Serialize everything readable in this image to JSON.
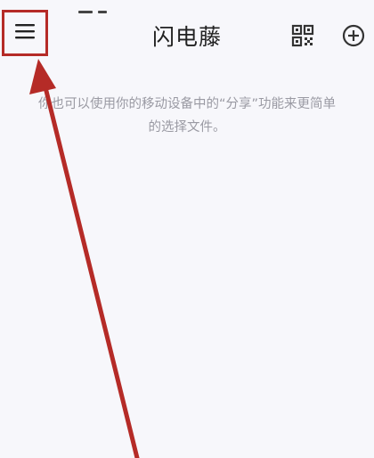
{
  "app": {
    "title": "闪电藤"
  },
  "toolbar": {
    "menu_icon": "hamburger-menu-icon",
    "qr_icon": "qr-code-icon",
    "add_icon": "add-circle-icon"
  },
  "empty_state": {
    "line1": "你也可以使用你的移动设备中的“分享”功能来更简单",
    "line2": "的选择文件。"
  },
  "colors": {
    "background": "#f7f7fb",
    "annotation": "#b52b27",
    "hint_text": "#9a9aa3"
  }
}
